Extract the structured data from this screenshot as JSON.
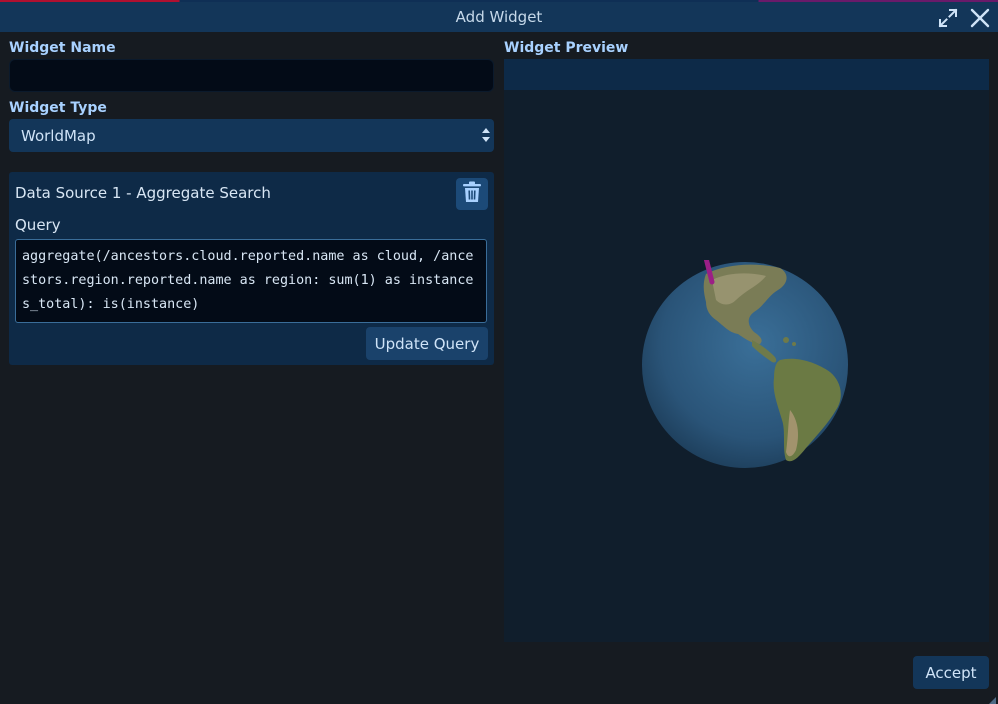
{
  "window": {
    "title": "Add Widget",
    "maximize_icon": "maximize-icon",
    "close_icon": "close-icon"
  },
  "widget_name": {
    "label": "Widget Name",
    "value": "",
    "placeholder": ""
  },
  "widget_type": {
    "label": "Widget Type",
    "selected": "WorldMap"
  },
  "data_source": {
    "title": "Data Source 1 - Aggregate Search",
    "delete_icon": "trash-icon",
    "query_label": "Query",
    "query": "aggregate(/ancestors.cloud.reported.name as cloud, /ancestors.region.reported.name as region: sum(1) as instances_total): is(instance)",
    "update_label": "Update Query"
  },
  "preview": {
    "label": "Widget Preview",
    "globe_icon": "globe-icon"
  },
  "footer": {
    "accept_label": "Accept"
  },
  "colors": {
    "titlebar": "#133659",
    "label": "#a8d1ff",
    "panel": "#0e2a47",
    "marker": "#9c1f86"
  }
}
